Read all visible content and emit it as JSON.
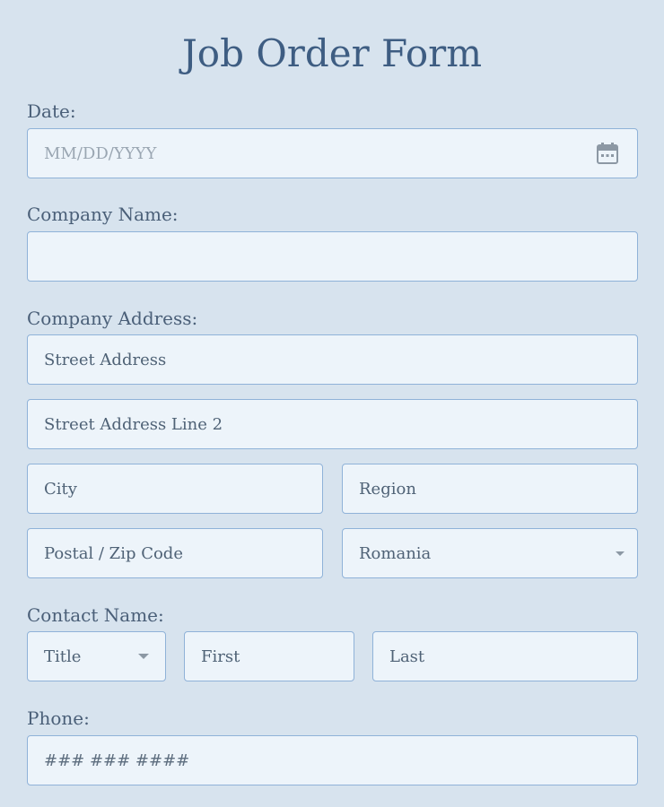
{
  "form": {
    "title": "Job Order Form"
  },
  "date": {
    "label": "Date:",
    "placeholder": "MM/DD/YYYY",
    "icon": "calendar-icon"
  },
  "company_name": {
    "label": "Company Name:",
    "value": ""
  },
  "company_address": {
    "label": "Company Address:",
    "street": "Street Address",
    "street2": "Street Address Line 2",
    "city": "City",
    "region": "Region",
    "postal": "Postal / Zip Code",
    "country": "Romania"
  },
  "contact_name": {
    "label": "Contact Name:",
    "title": "Title",
    "first": "First",
    "last": "Last"
  },
  "phone": {
    "label": "Phone:",
    "placeholder": "### ### ####"
  },
  "colors": {
    "background": "#d7e3ee",
    "field_bg": "#edf4fa",
    "field_border": "#8fb2d8",
    "title": "#3e5d82"
  }
}
